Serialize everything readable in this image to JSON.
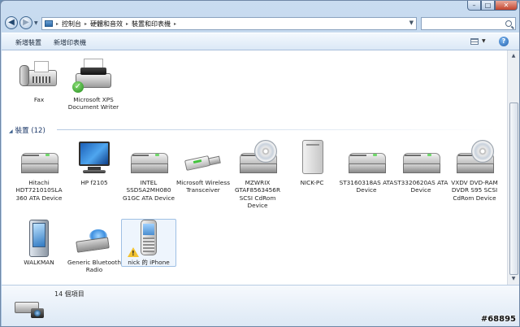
{
  "window": {
    "caption_buttons": [
      "–",
      "□",
      "✕"
    ]
  },
  "address": {
    "crumbs": [
      "控制台",
      "硬體和音效",
      "裝置和印表機"
    ],
    "separator": "▸",
    "search_placeholder": ""
  },
  "toolbar": {
    "add_device": "新增裝置",
    "add_printer": "新增印表機",
    "help": "?"
  },
  "printers": [
    {
      "label": "Fax",
      "icon": "fax-icon"
    },
    {
      "label": "Microsoft XPS Document Writer",
      "icon": "printer-icon",
      "default": true
    }
  ],
  "devices_group": {
    "title": "裝置 (12)",
    "items": [
      {
        "label": "Hitachi HDT721010SLA 360 ATA Device",
        "icon": "hard-drive-icon"
      },
      {
        "label": "HP f2105",
        "icon": "monitor-icon"
      },
      {
        "label": "INTEL SSDSA2MH080 G1GC ATA Device",
        "icon": "hard-drive-icon"
      },
      {
        "label": "Microsoft Wireless Transceiver",
        "icon": "usb-transceiver-icon"
      },
      {
        "label": "MZWRIX GTAF8563456R SCSI CdRom Device",
        "icon": "cdrom-drive-icon"
      },
      {
        "label": "NICK-PC",
        "icon": "computer-tower-icon"
      },
      {
        "label": "ST3160318AS ATA Device",
        "icon": "hard-drive-icon"
      },
      {
        "label": "ST3320620AS ATA Device",
        "icon": "hard-drive-icon"
      },
      {
        "label": "VXDV DVD-RAM DVDR S95 SCSI CdRom Device",
        "icon": "cdrom-drive-icon"
      },
      {
        "label": "WALKMAN",
        "icon": "walkman-player-icon"
      },
      {
        "label": "Generic Bluetooth Radio",
        "icon": "bluetooth-radio-icon"
      },
      {
        "label": "nick 的 iPhone",
        "icon": "phone-icon",
        "warning": true
      }
    ]
  },
  "details": {
    "count": "14 個項目"
  },
  "watermark": "#68895",
  "colors": {
    "titlebar": "#c9dcf0",
    "selection": "#eef5fd",
    "group_header": "#1e3a6a"
  }
}
